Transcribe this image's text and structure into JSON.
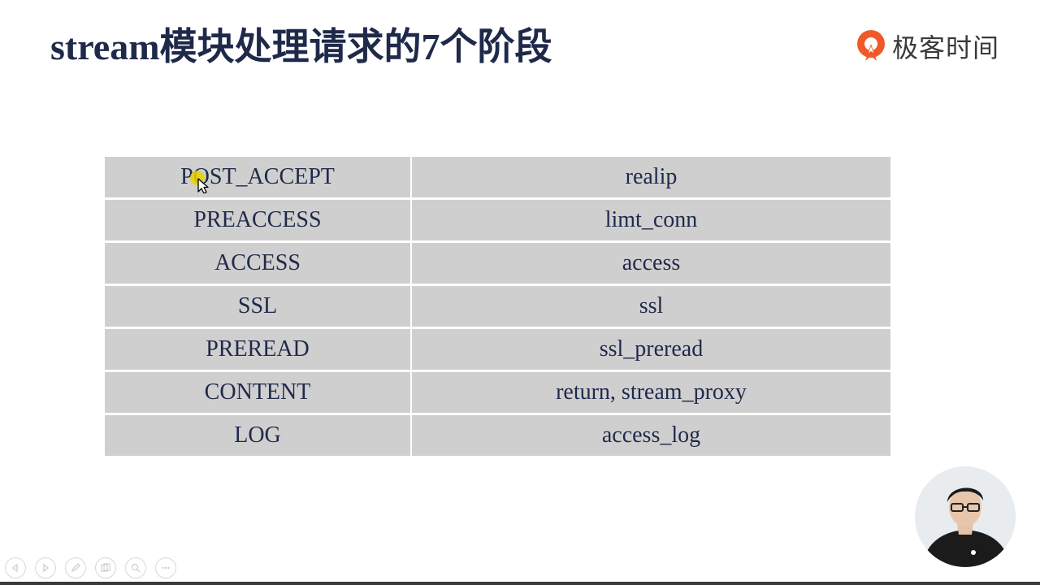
{
  "slide": {
    "title": "stream模块处理请求的7个阶段"
  },
  "brand": {
    "name": "极客时间",
    "logo_icon": "geektime-logo-icon",
    "accent_color": "#f05a28"
  },
  "table": {
    "rows": [
      {
        "phase": "POST_ACCEPT",
        "modules": "realip"
      },
      {
        "phase": "PREACCESS",
        "modules": "limt_conn"
      },
      {
        "phase": "ACCESS",
        "modules": "access"
      },
      {
        "phase": "SSL",
        "modules": "ssl"
      },
      {
        "phase": "PREREAD",
        "modules": "ssl_preread"
      },
      {
        "phase": "CONTENT",
        "modules": "return, stream_proxy"
      },
      {
        "phase": "LOG",
        "modules": "access_log"
      }
    ],
    "cell_color": "#d0cfcf",
    "text_color": "#1f2a4a"
  },
  "controls": {
    "items": [
      {
        "icon": "previous-icon"
      },
      {
        "icon": "next-icon"
      },
      {
        "icon": "pen-icon"
      },
      {
        "icon": "slides-icon"
      },
      {
        "icon": "zoom-icon"
      },
      {
        "icon": "more-icon"
      }
    ]
  },
  "cursor": {
    "icon": "pointer-cursor-icon",
    "highlight_color": "#e6d200"
  },
  "presenter": {
    "icon": "presenter-video-icon"
  }
}
